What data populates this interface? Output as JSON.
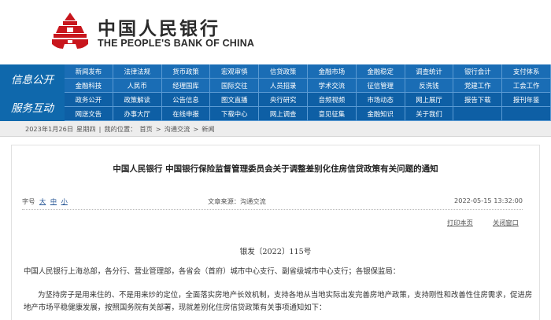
{
  "header": {
    "brand_cn": "中国人民银行",
    "brand_en": "THE PEOPLE'S BANK OF CHINA",
    "logo_icon": "pboc-emblem-icon",
    "brand_color": "#c8161d"
  },
  "nav": {
    "label_info": "信息公开",
    "label_service": "服务互动",
    "rows": [
      [
        "新闻发布",
        "法律法规",
        "货币政策",
        "宏观审慎",
        "信贷政策",
        "金融市场",
        "金融稳定",
        "调查统计",
        "银行会计",
        "支付体系"
      ],
      [
        "金融科技",
        "人民币",
        "经理国库",
        "国际交往",
        "人员招录",
        "学术交流",
        "征信管理",
        "反洗钱",
        "党建工作",
        "工会工作"
      ],
      [
        "政务公开",
        "政策解读",
        "公告信息",
        "图文直播",
        "央行研究",
        "音频视频",
        "市场动态",
        "网上展厅",
        "报告下载",
        "报刊年鉴"
      ],
      [
        "网送文告",
        "办事大厅",
        "在线申报",
        "下载中心",
        "网上调查",
        "意见征集",
        "金融知识",
        "关于我们",
        "",
        ""
      ]
    ],
    "colors": {
      "bar": "#0d5597",
      "cell": "#1a6db5"
    }
  },
  "breadcrumb": {
    "date": "2023年1月26日",
    "weekday": "星期四",
    "prefix": "我的位置：",
    "home": "首页",
    "sep1": ">",
    "section": "沟通交流",
    "sep2": ">",
    "current": "新闻"
  },
  "article": {
    "title": "中国人民银行  中国银行保险监督管理委员会关于调整差别化住房信贷政策有关问题的通知",
    "font_size_label": "字号",
    "font_size_large": "大",
    "font_size_medium": "中",
    "font_size_small": "小",
    "source": "文章来源：沟通交流",
    "date": "2022-05-15 13:32:00",
    "print_label": "打印本页",
    "close_label": "关闭窗口",
    "doc_number": "银发〔2022〕115号",
    "para1": "中国人民银行上海总部，各分行、营业管理部，各省会（首府）城市中心支行、副省级城市中心支行；各银保监局：",
    "para2": "为坚持房子是用来住的、不是用来炒的定位，全面落实房地产长效机制，支持各地从当地实际出发完善房地产政策，支持刚性和改善性住房需求，促进房地产市场平稳健康发展，按照国务院有关部署，现就差别化住房信贷政策有关事项通知如下："
  }
}
